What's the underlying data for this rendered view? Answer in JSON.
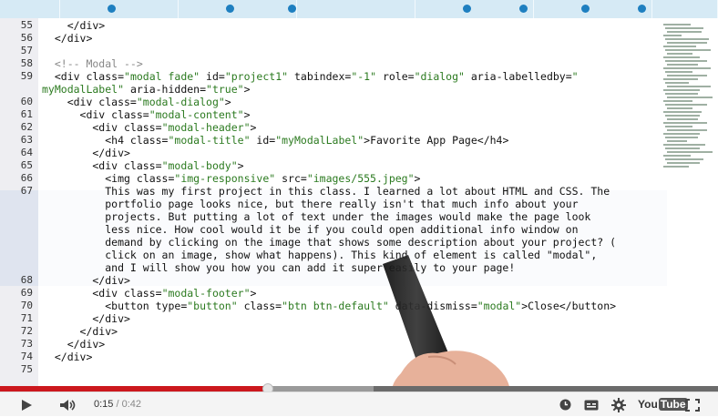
{
  "editor": {
    "lines": [
      {
        "num": "55",
        "segments": [
          {
            "t": "t",
            "v": "    </div>"
          }
        ]
      },
      {
        "num": "56",
        "segments": [
          {
            "t": "t",
            "v": "  </div>"
          }
        ]
      },
      {
        "num": "57",
        "segments": [
          {
            "t": "t",
            "v": ""
          }
        ]
      },
      {
        "num": "58",
        "segments": [
          {
            "t": "c",
            "v": "  <!-- Modal -->"
          }
        ]
      },
      {
        "num": "59",
        "segments": [
          {
            "t": "t",
            "v": "  <div class="
          },
          {
            "t": "s",
            "v": "\"modal fade\""
          },
          {
            "t": "t",
            "v": " id="
          },
          {
            "t": "s",
            "v": "\"project1\""
          },
          {
            "t": "t",
            "v": " tabindex="
          },
          {
            "t": "s",
            "v": "\"-1\""
          },
          {
            "t": "t",
            "v": " role="
          },
          {
            "t": "s",
            "v": "\"dialog\""
          },
          {
            "t": "t",
            "v": " aria-labelledby="
          },
          {
            "t": "s",
            "v": "\""
          }
        ]
      },
      {
        "num": "",
        "segments": [
          {
            "t": "s",
            "v": "myModalLabel\""
          },
          {
            "t": "t",
            "v": " aria-hidden="
          },
          {
            "t": "s",
            "v": "\"true\""
          },
          {
            "t": "t",
            "v": ">"
          }
        ]
      },
      {
        "num": "60",
        "segments": [
          {
            "t": "t",
            "v": "    <div class="
          },
          {
            "t": "s",
            "v": "\"modal-dialog\""
          },
          {
            "t": "t",
            "v": ">"
          }
        ]
      },
      {
        "num": "61",
        "segments": [
          {
            "t": "t",
            "v": "      <div class="
          },
          {
            "t": "s",
            "v": "\"modal-content\""
          },
          {
            "t": "t",
            "v": ">"
          }
        ]
      },
      {
        "num": "62",
        "segments": [
          {
            "t": "t",
            "v": "        <div class="
          },
          {
            "t": "s",
            "v": "\"modal-header\""
          },
          {
            "t": "t",
            "v": ">"
          }
        ]
      },
      {
        "num": "63",
        "segments": [
          {
            "t": "t",
            "v": "          <h4 class="
          },
          {
            "t": "s",
            "v": "\"modal-title\""
          },
          {
            "t": "t",
            "v": " id="
          },
          {
            "t": "s",
            "v": "\"myModalLabel\""
          },
          {
            "t": "t",
            "v": ">Favorite App Page</h4>"
          }
        ]
      },
      {
        "num": "64",
        "segments": [
          {
            "t": "t",
            "v": "        </div>"
          }
        ]
      },
      {
        "num": "65",
        "segments": [
          {
            "t": "t",
            "v": "        <div class="
          },
          {
            "t": "s",
            "v": "\"modal-body\""
          },
          {
            "t": "t",
            "v": ">"
          }
        ]
      },
      {
        "num": "66",
        "segments": [
          {
            "t": "t",
            "v": "          <img class="
          },
          {
            "t": "s",
            "v": "\"img-responsive\""
          },
          {
            "t": "t",
            "v": " src="
          },
          {
            "t": "s",
            "v": "\"images/555.jpeg\""
          },
          {
            "t": "t",
            "v": ">"
          }
        ]
      },
      {
        "num": "67",
        "segments": [
          {
            "t": "t",
            "v": "          This was my first project in this class. I learned a lot about HTML and CSS. The"
          }
        ]
      },
      {
        "num": "",
        "segments": [
          {
            "t": "t",
            "v": "          portfolio page looks nice, but there really isn't that much info about your"
          }
        ]
      },
      {
        "num": "",
        "segments": [
          {
            "t": "t",
            "v": "          projects. But putting a lot of text under the images would make the page look"
          }
        ]
      },
      {
        "num": "",
        "segments": [
          {
            "t": "t",
            "v": "          less nice. How cool would it be if you could open additional info window on"
          }
        ]
      },
      {
        "num": "",
        "segments": [
          {
            "t": "t",
            "v": "          demand by clicking on the image that shows some description about your project? ("
          }
        ]
      },
      {
        "num": "",
        "segments": [
          {
            "t": "t",
            "v": "          click on an image, show what happens). This kind of element is called \"modal\","
          }
        ]
      },
      {
        "num": "",
        "segments": [
          {
            "t": "t",
            "v": "          and I will show you how you can add it super easily to your page!"
          }
        ]
      },
      {
        "num": "68",
        "segments": [
          {
            "t": "t",
            "v": "        </div>"
          }
        ]
      },
      {
        "num": "69",
        "segments": [
          {
            "t": "t",
            "v": "        <div class="
          },
          {
            "t": "s",
            "v": "\"modal-footer\""
          },
          {
            "t": "t",
            "v": ">"
          }
        ]
      },
      {
        "num": "70",
        "segments": [
          {
            "t": "t",
            "v": "          <button type="
          },
          {
            "t": "s",
            "v": "\"button\""
          },
          {
            "t": "t",
            "v": " class="
          },
          {
            "t": "s",
            "v": "\"btn btn-default\""
          },
          {
            "t": "t",
            "v": " data-dismiss="
          },
          {
            "t": "s",
            "v": "\"modal\""
          },
          {
            "t": "t",
            "v": ">Close</button>"
          }
        ]
      },
      {
        "num": "71",
        "segments": [
          {
            "t": "t",
            "v": "        </div>"
          }
        ]
      },
      {
        "num": "72",
        "segments": [
          {
            "t": "t",
            "v": "      </div>"
          }
        ]
      },
      {
        "num": "73",
        "segments": [
          {
            "t": "t",
            "v": "    </div>"
          }
        ]
      },
      {
        "num": "74",
        "segments": [
          {
            "t": "t",
            "v": "  </div>"
          }
        ]
      },
      {
        "num": "75",
        "segments": [
          {
            "t": "t",
            "v": ""
          }
        ]
      }
    ]
  },
  "player": {
    "current_time": "0:15",
    "separator": "/",
    "duration": "0:42",
    "played_fraction": 0.373,
    "buffered_fraction": 0.52,
    "youtube_logo_you": "You",
    "youtube_logo_tube": "Tube"
  },
  "colors": {
    "progress_red": "#cc181e",
    "tab_accent": "#1e7fc0",
    "string_green": "#2b7a1f"
  },
  "icons": {
    "play": "play-icon",
    "volume": "volume-icon",
    "watch_later": "clock-icon",
    "captions": "captions-icon",
    "settings": "gear-icon",
    "fullscreen": "fullscreen-icon"
  }
}
